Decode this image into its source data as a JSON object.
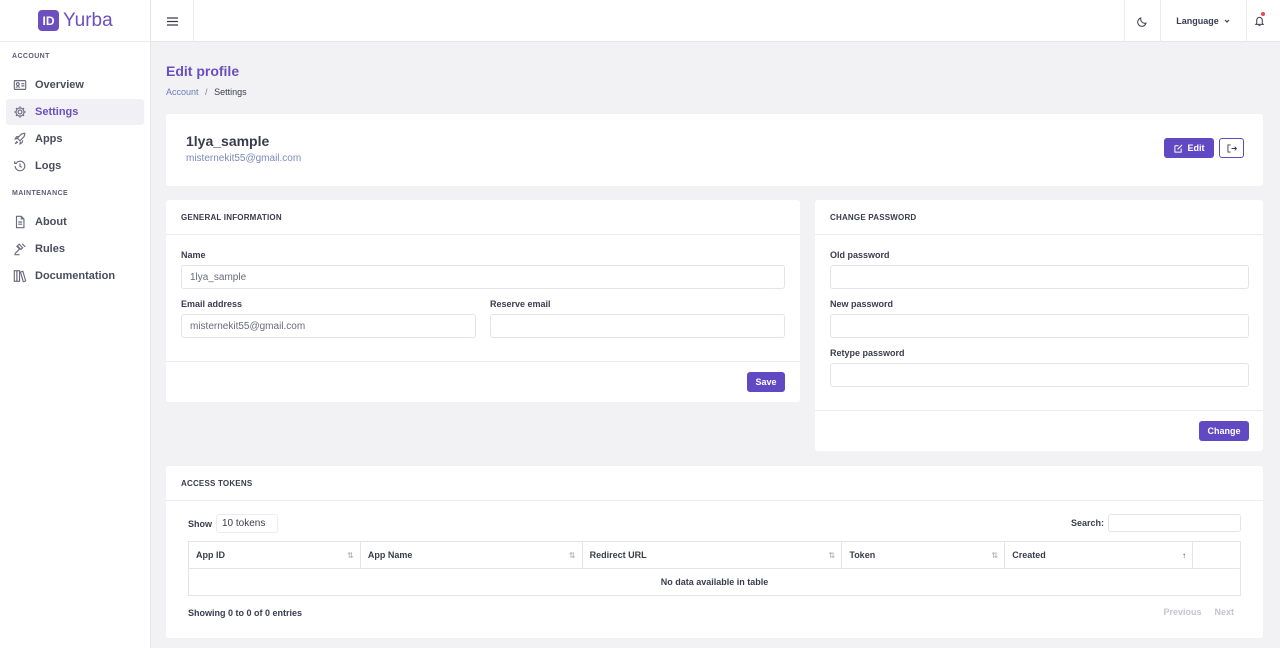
{
  "brand": {
    "logo_mark": "ID",
    "name": "Yurba"
  },
  "sidebar": {
    "sections": [
      {
        "title": "ACCOUNT",
        "items": [
          {
            "label": "Overview",
            "icon": "id-card-icon",
            "active": false
          },
          {
            "label": "Settings",
            "icon": "gear-icon",
            "active": true
          },
          {
            "label": "Apps",
            "icon": "rocket-icon",
            "active": false
          },
          {
            "label": "Logs",
            "icon": "history-icon",
            "active": false
          }
        ]
      },
      {
        "title": "MAINTENANCE",
        "items": [
          {
            "label": "About",
            "icon": "document-icon",
            "active": false
          },
          {
            "label": "Rules",
            "icon": "gavel-icon",
            "active": false
          },
          {
            "label": "Documentation",
            "icon": "books-icon",
            "active": false
          }
        ]
      }
    ]
  },
  "topbar": {
    "language_label": "Language"
  },
  "page": {
    "title": "Edit profile",
    "breadcrumb": {
      "parent": "Account",
      "separator": "/",
      "current": "Settings"
    }
  },
  "profile": {
    "username": "1lya_sample",
    "email": "misternekit55@gmail.com",
    "edit_label": "Edit"
  },
  "general": {
    "header": "GENERAL INFORMATION",
    "name_label": "Name",
    "name_value": "1lya_sample",
    "email_label": "Email address",
    "email_value": "misternekit55@gmail.com",
    "reserve_label": "Reserve email",
    "reserve_value": "",
    "save_label": "Save"
  },
  "password": {
    "header": "CHANGE PASSWORD",
    "old_label": "Old password",
    "new_label": "New password",
    "retype_label": "Retype password",
    "change_label": "Change"
  },
  "tokens": {
    "header": "ACCESS TOKENS",
    "show_label": "Show",
    "page_size": "10 tokens",
    "search_label": "Search:",
    "columns": [
      "App ID",
      "App Name",
      "Redirect URL",
      "Token",
      "Created"
    ],
    "empty": "No data available in table",
    "info": "Showing 0 to 0 of 0 entries",
    "prev_label": "Previous",
    "next_label": "Next"
  },
  "colors": {
    "accent": "#6149c4",
    "brand": "#6b4fbf",
    "notification_dot": "#e5484d"
  }
}
